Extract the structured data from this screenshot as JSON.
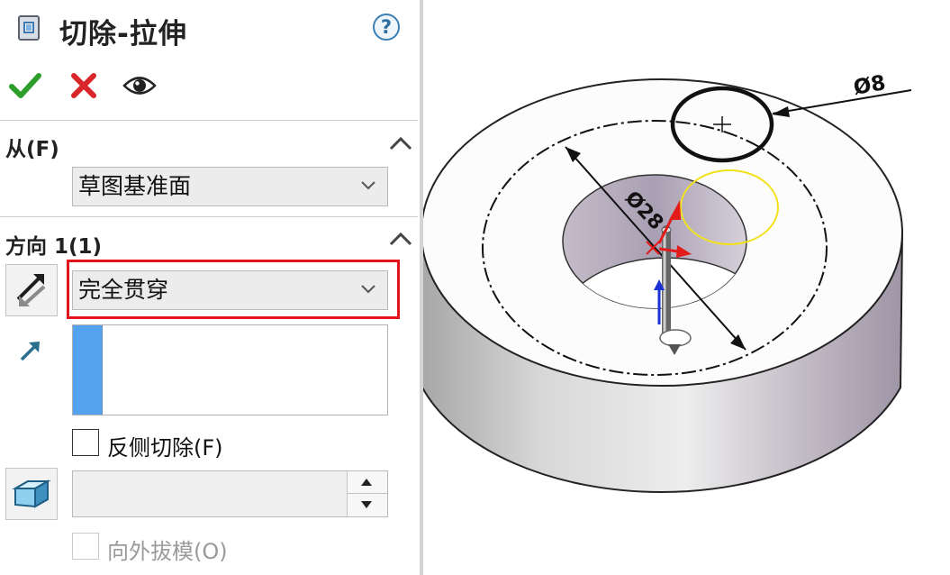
{
  "feature": {
    "title": "切除-拉伸",
    "icon": "cut-extrude-icon",
    "help_icon": "question-mark-icon",
    "help_glyph": "?"
  },
  "toolbar": {
    "ok_icon": "green-check-icon",
    "cancel_icon": "red-x-icon",
    "preview_icon": "eye-icon"
  },
  "from_section": {
    "title": "从(F)",
    "collapse_icon": "chevron-up-icon",
    "start_condition": "草图基准面"
  },
  "direction1_section": {
    "title": "方向 1(1)",
    "collapse_icon": "chevron-up-icon",
    "reverse_direction_icon": "reverse-direction-icon",
    "end_condition": "完全贯穿",
    "direction_vector_icon": "direction-arrow-icon",
    "direction_selection": [],
    "flip_side_to_cut": {
      "label": "反侧切除(F)",
      "checked": false
    },
    "draft_icon": "draft-icon",
    "draft_angle_value": "",
    "draft_outward": {
      "label": "向外拔模(O)",
      "checked": false,
      "enabled": false
    }
  },
  "graphics": {
    "dim_outer": "Ø8",
    "dim_inner": "Ø28"
  },
  "colors": {
    "highlight_border": "#e3141b",
    "ok_green": "#2e9e2a",
    "cancel_red": "#d9262a",
    "selection_strip": "#55a3ee",
    "sketch_preview": "#f2e21c"
  }
}
